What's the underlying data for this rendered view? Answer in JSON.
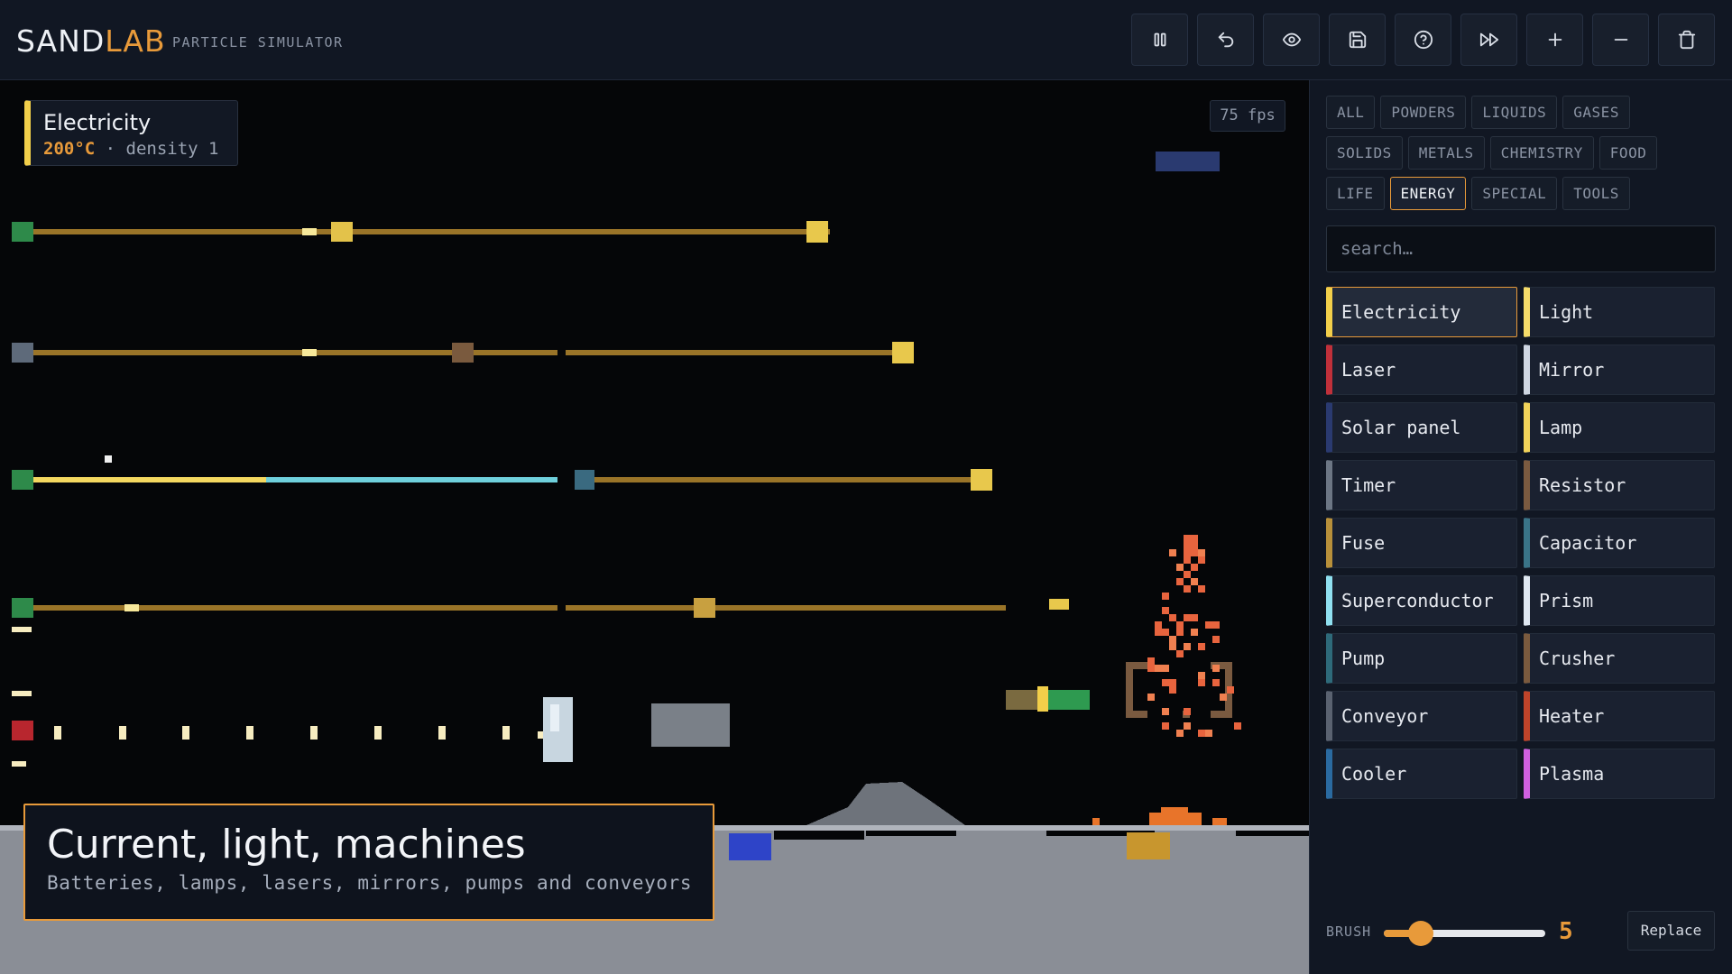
{
  "app": {
    "logo_main": "SAND",
    "logo_accent": "LAB",
    "subtitle": "PARTICLE SIMULATOR"
  },
  "toolbar": [
    {
      "icon": "pause-icon",
      "name": "pause-button"
    },
    {
      "icon": "undo-icon",
      "name": "undo-button"
    },
    {
      "icon": "eye-icon",
      "name": "view-button"
    },
    {
      "icon": "save-icon",
      "name": "save-button"
    },
    {
      "icon": "help-icon",
      "name": "help-button"
    },
    {
      "icon": "fast-forward-icon",
      "name": "fast-forward-button"
    },
    {
      "icon": "plus-icon",
      "name": "zoom-in-button"
    },
    {
      "icon": "minus-icon",
      "name": "zoom-out-button"
    },
    {
      "icon": "trash-icon",
      "name": "clear-button"
    }
  ],
  "info": {
    "name": "Electricity",
    "temperature": "200°C",
    "separator": " · ",
    "density": "density 1",
    "color": "#f2cf4a"
  },
  "fps": "75 fps",
  "caption": {
    "title": "Current, light, machines",
    "subtitle": "Batteries, lamps, lasers, mirrors, pumps and conveyors"
  },
  "categories": [
    {
      "label": "ALL",
      "active": false
    },
    {
      "label": "POWDERS",
      "active": false
    },
    {
      "label": "LIQUIDS",
      "active": false
    },
    {
      "label": "GASES",
      "active": false
    },
    {
      "label": "SOLIDS",
      "active": false
    },
    {
      "label": "METALS",
      "active": false
    },
    {
      "label": "CHEMISTRY",
      "active": false
    },
    {
      "label": "FOOD",
      "active": false
    },
    {
      "label": "LIFE",
      "active": false
    },
    {
      "label": "ENERGY",
      "active": true
    },
    {
      "label": "SPECIAL",
      "active": false
    },
    {
      "label": "TOOLS",
      "active": false
    }
  ],
  "search": {
    "placeholder": "search…",
    "value": ""
  },
  "elements": [
    {
      "label": "Electricity",
      "color": "#f2cf4a",
      "selected": true
    },
    {
      "label": "Light",
      "color": "#f5dc6a",
      "selected": false
    },
    {
      "label": "Laser",
      "color": "#c0303a",
      "selected": false
    },
    {
      "label": "Mirror",
      "color": "#cfd6e2",
      "selected": false
    },
    {
      "label": "Solar panel",
      "color": "#2a3a70",
      "selected": false
    },
    {
      "label": "Lamp",
      "color": "#f2d35a",
      "selected": false
    },
    {
      "label": "Timer",
      "color": "#6c7684",
      "selected": false
    },
    {
      "label": "Resistor",
      "color": "#7a5a40",
      "selected": false
    },
    {
      "label": "Fuse",
      "color": "#b8903a",
      "selected": false
    },
    {
      "label": "Capacitor",
      "color": "#3a7488",
      "selected": false
    },
    {
      "label": "Superconductor",
      "color": "#8fe0f0",
      "selected": false
    },
    {
      "label": "Prism",
      "color": "#dfe8f2",
      "selected": false
    },
    {
      "label": "Pump",
      "color": "#2e6a7a",
      "selected": false
    },
    {
      "label": "Crusher",
      "color": "#7a5a3e",
      "selected": false
    },
    {
      "label": "Conveyor",
      "color": "#5a6270",
      "selected": false
    },
    {
      "label": "Heater",
      "color": "#c0442a",
      "selected": false
    },
    {
      "label": "Cooler",
      "color": "#2a6aa0",
      "selected": false
    },
    {
      "label": "Plasma",
      "color": "#d060e0",
      "selected": false
    }
  ],
  "brush": {
    "label": "BRUSH",
    "value": "5",
    "level": 0.23
  },
  "replace_label": "Replace"
}
